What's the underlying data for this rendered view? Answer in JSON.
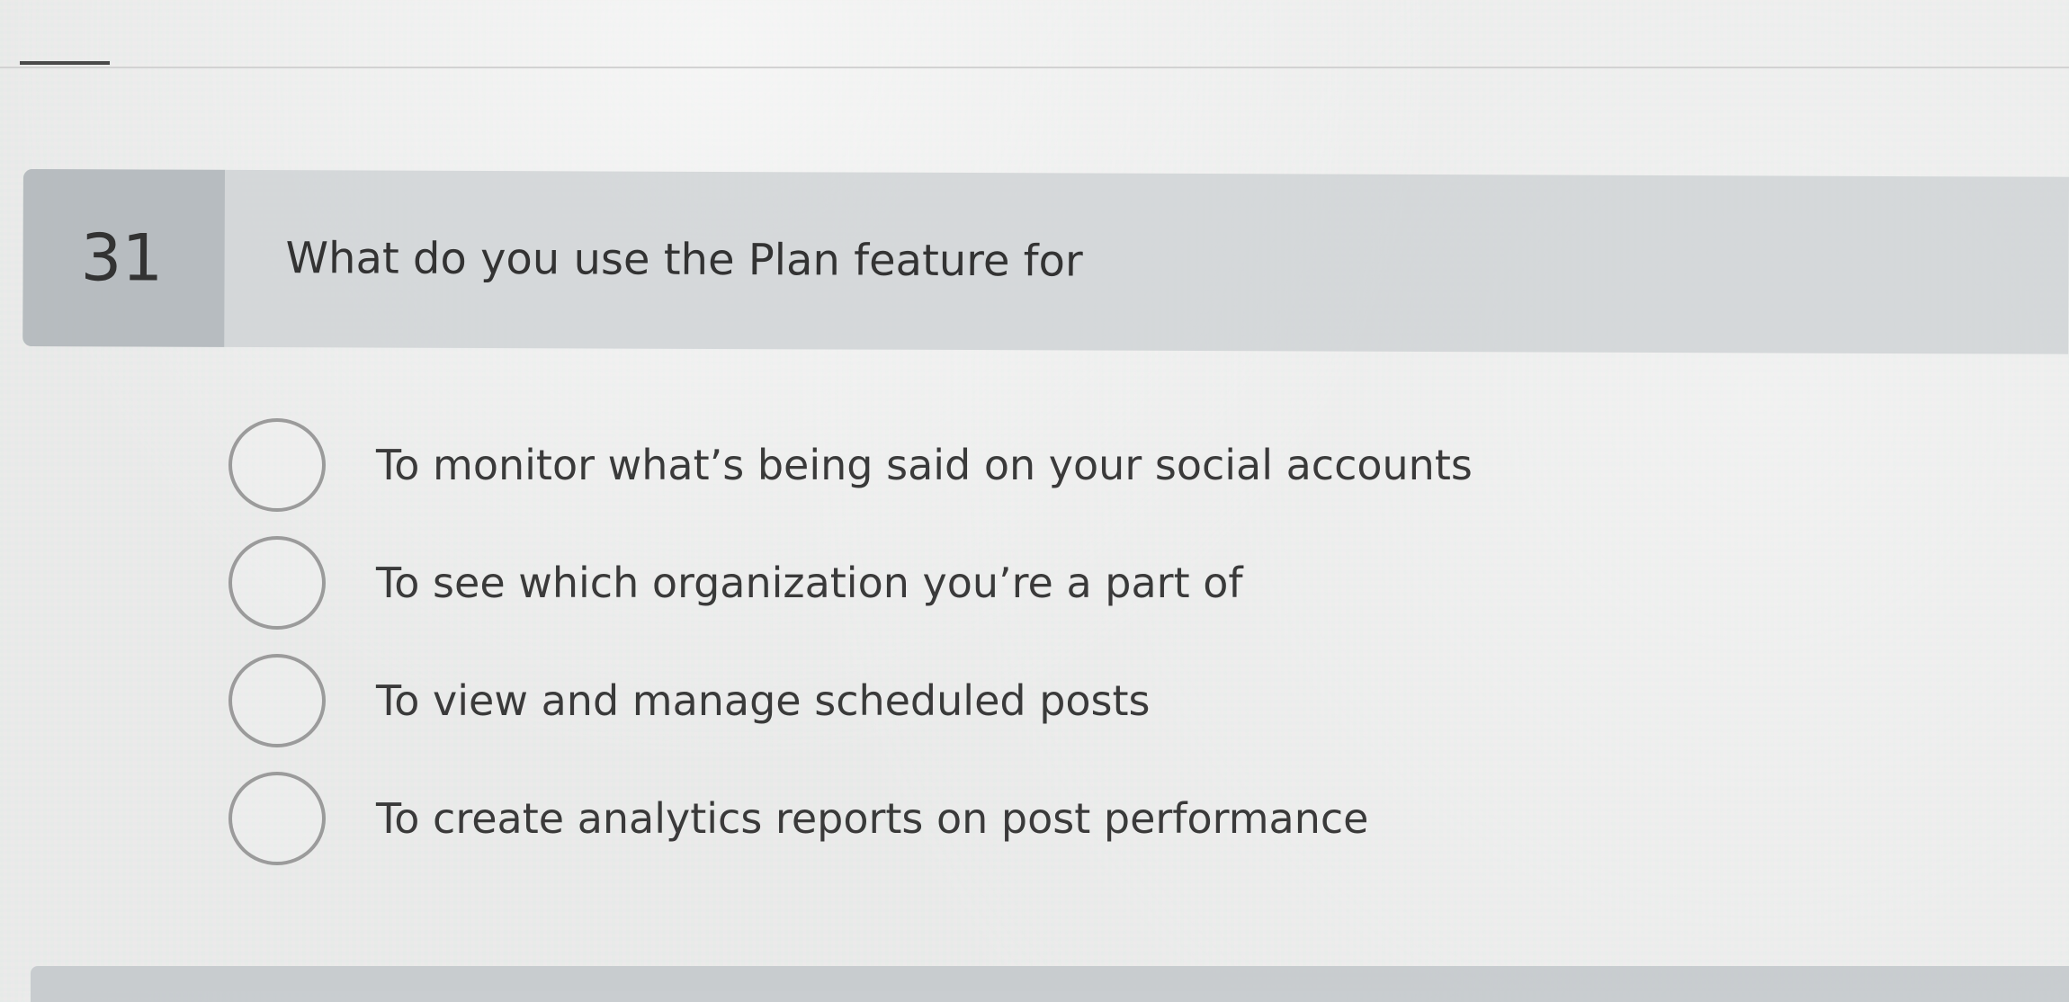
{
  "question": {
    "number": "31",
    "text": "What do you use the Plan feature for"
  },
  "options": [
    {
      "label": "To monitor what’s being said on your social accounts",
      "selected": false
    },
    {
      "label": "To see which organization you’re a part of",
      "selected": false
    },
    {
      "label": "To view and manage scheduled posts",
      "selected": false
    },
    {
      "label": "To create analytics reports on post performance",
      "selected": false
    }
  ],
  "colors": {
    "header_bg": "#cdd1d4",
    "number_bg": "#b2b7bb",
    "text": "#333333",
    "radio_border": "#9b9b9b"
  }
}
